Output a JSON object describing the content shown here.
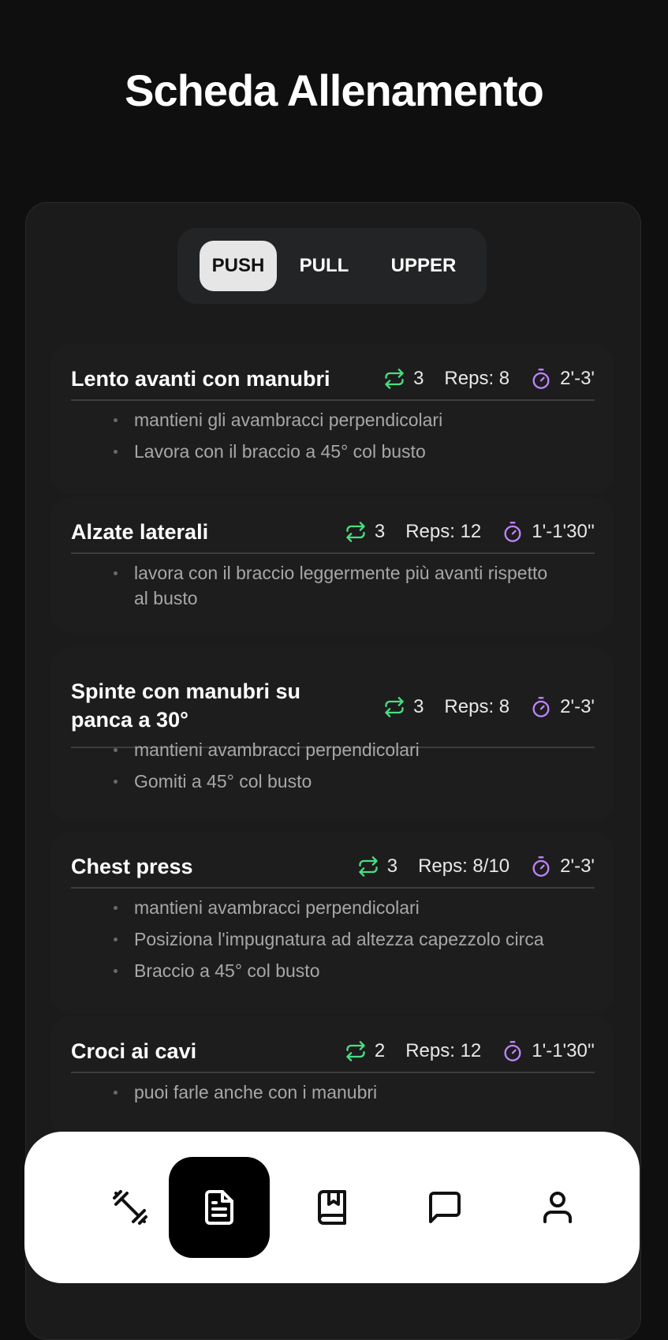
{
  "page": {
    "title": "Scheda Allenamento"
  },
  "tabs": [
    {
      "label": "PUSH",
      "active": true
    },
    {
      "label": "PULL",
      "active": false
    },
    {
      "label": "UPPER",
      "active": false
    }
  ],
  "icons": {
    "sets": "repeat-icon",
    "rest": "stopwatch-icon"
  },
  "colors": {
    "sets_icon": "#4ade80",
    "rest_icon": "#c084fc",
    "background": "#0f0f0f",
    "card": "#1b1b1c"
  },
  "exercises": [
    {
      "name": "Lento avanti con manubri",
      "sets": "3",
      "reps": "Reps: 8",
      "rest": "2'-3'",
      "notes": [
        "mantieni gli avambracci perpendicolari",
        "Lavora con il braccio a 45° col busto"
      ]
    },
    {
      "name": "Alzate laterali",
      "sets": "3",
      "reps": "Reps: 12",
      "rest": "1'-1'30''",
      "notes": [
        "lavora con il braccio leggermente più avanti rispetto al busto"
      ]
    },
    {
      "name": "Spinte con manubri su panca a 30°",
      "sets": "3",
      "reps": "Reps: 8",
      "rest": "2'-3'",
      "notes": [
        "mantieni avambracci perpendicolari",
        "Gomiti a 45° col busto"
      ]
    },
    {
      "name": "Chest press",
      "sets": "3",
      "reps": "Reps: 8/10",
      "rest": "2'-3'",
      "notes": [
        "mantieni avambracci perpendicolari",
        "Posiziona l'impugnatura ad altezza capezzolo circa",
        "Braccio a 45° col busto"
      ]
    },
    {
      "name": "Croci ai cavi",
      "sets": "2",
      "reps": "Reps: 12",
      "rest": "1'-1'30''",
      "notes": [
        "puoi farle anche con i manubri"
      ]
    }
  ],
  "bottom_nav": [
    {
      "icon": "dumbbell-icon",
      "active": false
    },
    {
      "icon": "document-icon",
      "active": true
    },
    {
      "icon": "bookmark-book-icon",
      "active": false
    },
    {
      "icon": "chat-icon",
      "active": false
    },
    {
      "icon": "user-icon",
      "active": false
    }
  ]
}
